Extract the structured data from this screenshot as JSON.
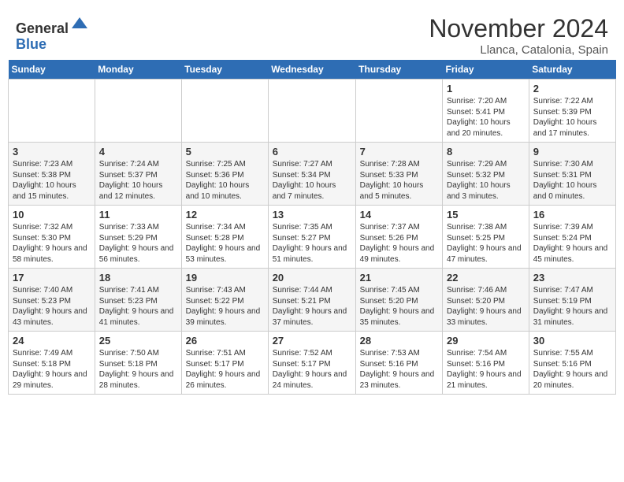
{
  "header": {
    "logo_general": "General",
    "logo_blue": "Blue",
    "month_title": "November 2024",
    "location": "Llanca, Catalonia, Spain"
  },
  "calendar": {
    "days_of_week": [
      "Sunday",
      "Monday",
      "Tuesday",
      "Wednesday",
      "Thursday",
      "Friday",
      "Saturday"
    ],
    "weeks": [
      [
        {
          "day": "",
          "info": ""
        },
        {
          "day": "",
          "info": ""
        },
        {
          "day": "",
          "info": ""
        },
        {
          "day": "",
          "info": ""
        },
        {
          "day": "",
          "info": ""
        },
        {
          "day": "1",
          "info": "Sunrise: 7:20 AM\nSunset: 5:41 PM\nDaylight: 10 hours and 20 minutes."
        },
        {
          "day": "2",
          "info": "Sunrise: 7:22 AM\nSunset: 5:39 PM\nDaylight: 10 hours and 17 minutes."
        }
      ],
      [
        {
          "day": "3",
          "info": "Sunrise: 7:23 AM\nSunset: 5:38 PM\nDaylight: 10 hours and 15 minutes."
        },
        {
          "day": "4",
          "info": "Sunrise: 7:24 AM\nSunset: 5:37 PM\nDaylight: 10 hours and 12 minutes."
        },
        {
          "day": "5",
          "info": "Sunrise: 7:25 AM\nSunset: 5:36 PM\nDaylight: 10 hours and 10 minutes."
        },
        {
          "day": "6",
          "info": "Sunrise: 7:27 AM\nSunset: 5:34 PM\nDaylight: 10 hours and 7 minutes."
        },
        {
          "day": "7",
          "info": "Sunrise: 7:28 AM\nSunset: 5:33 PM\nDaylight: 10 hours and 5 minutes."
        },
        {
          "day": "8",
          "info": "Sunrise: 7:29 AM\nSunset: 5:32 PM\nDaylight: 10 hours and 3 minutes."
        },
        {
          "day": "9",
          "info": "Sunrise: 7:30 AM\nSunset: 5:31 PM\nDaylight: 10 hours and 0 minutes."
        }
      ],
      [
        {
          "day": "10",
          "info": "Sunrise: 7:32 AM\nSunset: 5:30 PM\nDaylight: 9 hours and 58 minutes."
        },
        {
          "day": "11",
          "info": "Sunrise: 7:33 AM\nSunset: 5:29 PM\nDaylight: 9 hours and 56 minutes."
        },
        {
          "day": "12",
          "info": "Sunrise: 7:34 AM\nSunset: 5:28 PM\nDaylight: 9 hours and 53 minutes."
        },
        {
          "day": "13",
          "info": "Sunrise: 7:35 AM\nSunset: 5:27 PM\nDaylight: 9 hours and 51 minutes."
        },
        {
          "day": "14",
          "info": "Sunrise: 7:37 AM\nSunset: 5:26 PM\nDaylight: 9 hours and 49 minutes."
        },
        {
          "day": "15",
          "info": "Sunrise: 7:38 AM\nSunset: 5:25 PM\nDaylight: 9 hours and 47 minutes."
        },
        {
          "day": "16",
          "info": "Sunrise: 7:39 AM\nSunset: 5:24 PM\nDaylight: 9 hours and 45 minutes."
        }
      ],
      [
        {
          "day": "17",
          "info": "Sunrise: 7:40 AM\nSunset: 5:23 PM\nDaylight: 9 hours and 43 minutes."
        },
        {
          "day": "18",
          "info": "Sunrise: 7:41 AM\nSunset: 5:23 PM\nDaylight: 9 hours and 41 minutes."
        },
        {
          "day": "19",
          "info": "Sunrise: 7:43 AM\nSunset: 5:22 PM\nDaylight: 9 hours and 39 minutes."
        },
        {
          "day": "20",
          "info": "Sunrise: 7:44 AM\nSunset: 5:21 PM\nDaylight: 9 hours and 37 minutes."
        },
        {
          "day": "21",
          "info": "Sunrise: 7:45 AM\nSunset: 5:20 PM\nDaylight: 9 hours and 35 minutes."
        },
        {
          "day": "22",
          "info": "Sunrise: 7:46 AM\nSunset: 5:20 PM\nDaylight: 9 hours and 33 minutes."
        },
        {
          "day": "23",
          "info": "Sunrise: 7:47 AM\nSunset: 5:19 PM\nDaylight: 9 hours and 31 minutes."
        }
      ],
      [
        {
          "day": "24",
          "info": "Sunrise: 7:49 AM\nSunset: 5:18 PM\nDaylight: 9 hours and 29 minutes."
        },
        {
          "day": "25",
          "info": "Sunrise: 7:50 AM\nSunset: 5:18 PM\nDaylight: 9 hours and 28 minutes."
        },
        {
          "day": "26",
          "info": "Sunrise: 7:51 AM\nSunset: 5:17 PM\nDaylight: 9 hours and 26 minutes."
        },
        {
          "day": "27",
          "info": "Sunrise: 7:52 AM\nSunset: 5:17 PM\nDaylight: 9 hours and 24 minutes."
        },
        {
          "day": "28",
          "info": "Sunrise: 7:53 AM\nSunset: 5:16 PM\nDaylight: 9 hours and 23 minutes."
        },
        {
          "day": "29",
          "info": "Sunrise: 7:54 AM\nSunset: 5:16 PM\nDaylight: 9 hours and 21 minutes."
        },
        {
          "day": "30",
          "info": "Sunrise: 7:55 AM\nSunset: 5:16 PM\nDaylight: 9 hours and 20 minutes."
        }
      ]
    ]
  }
}
